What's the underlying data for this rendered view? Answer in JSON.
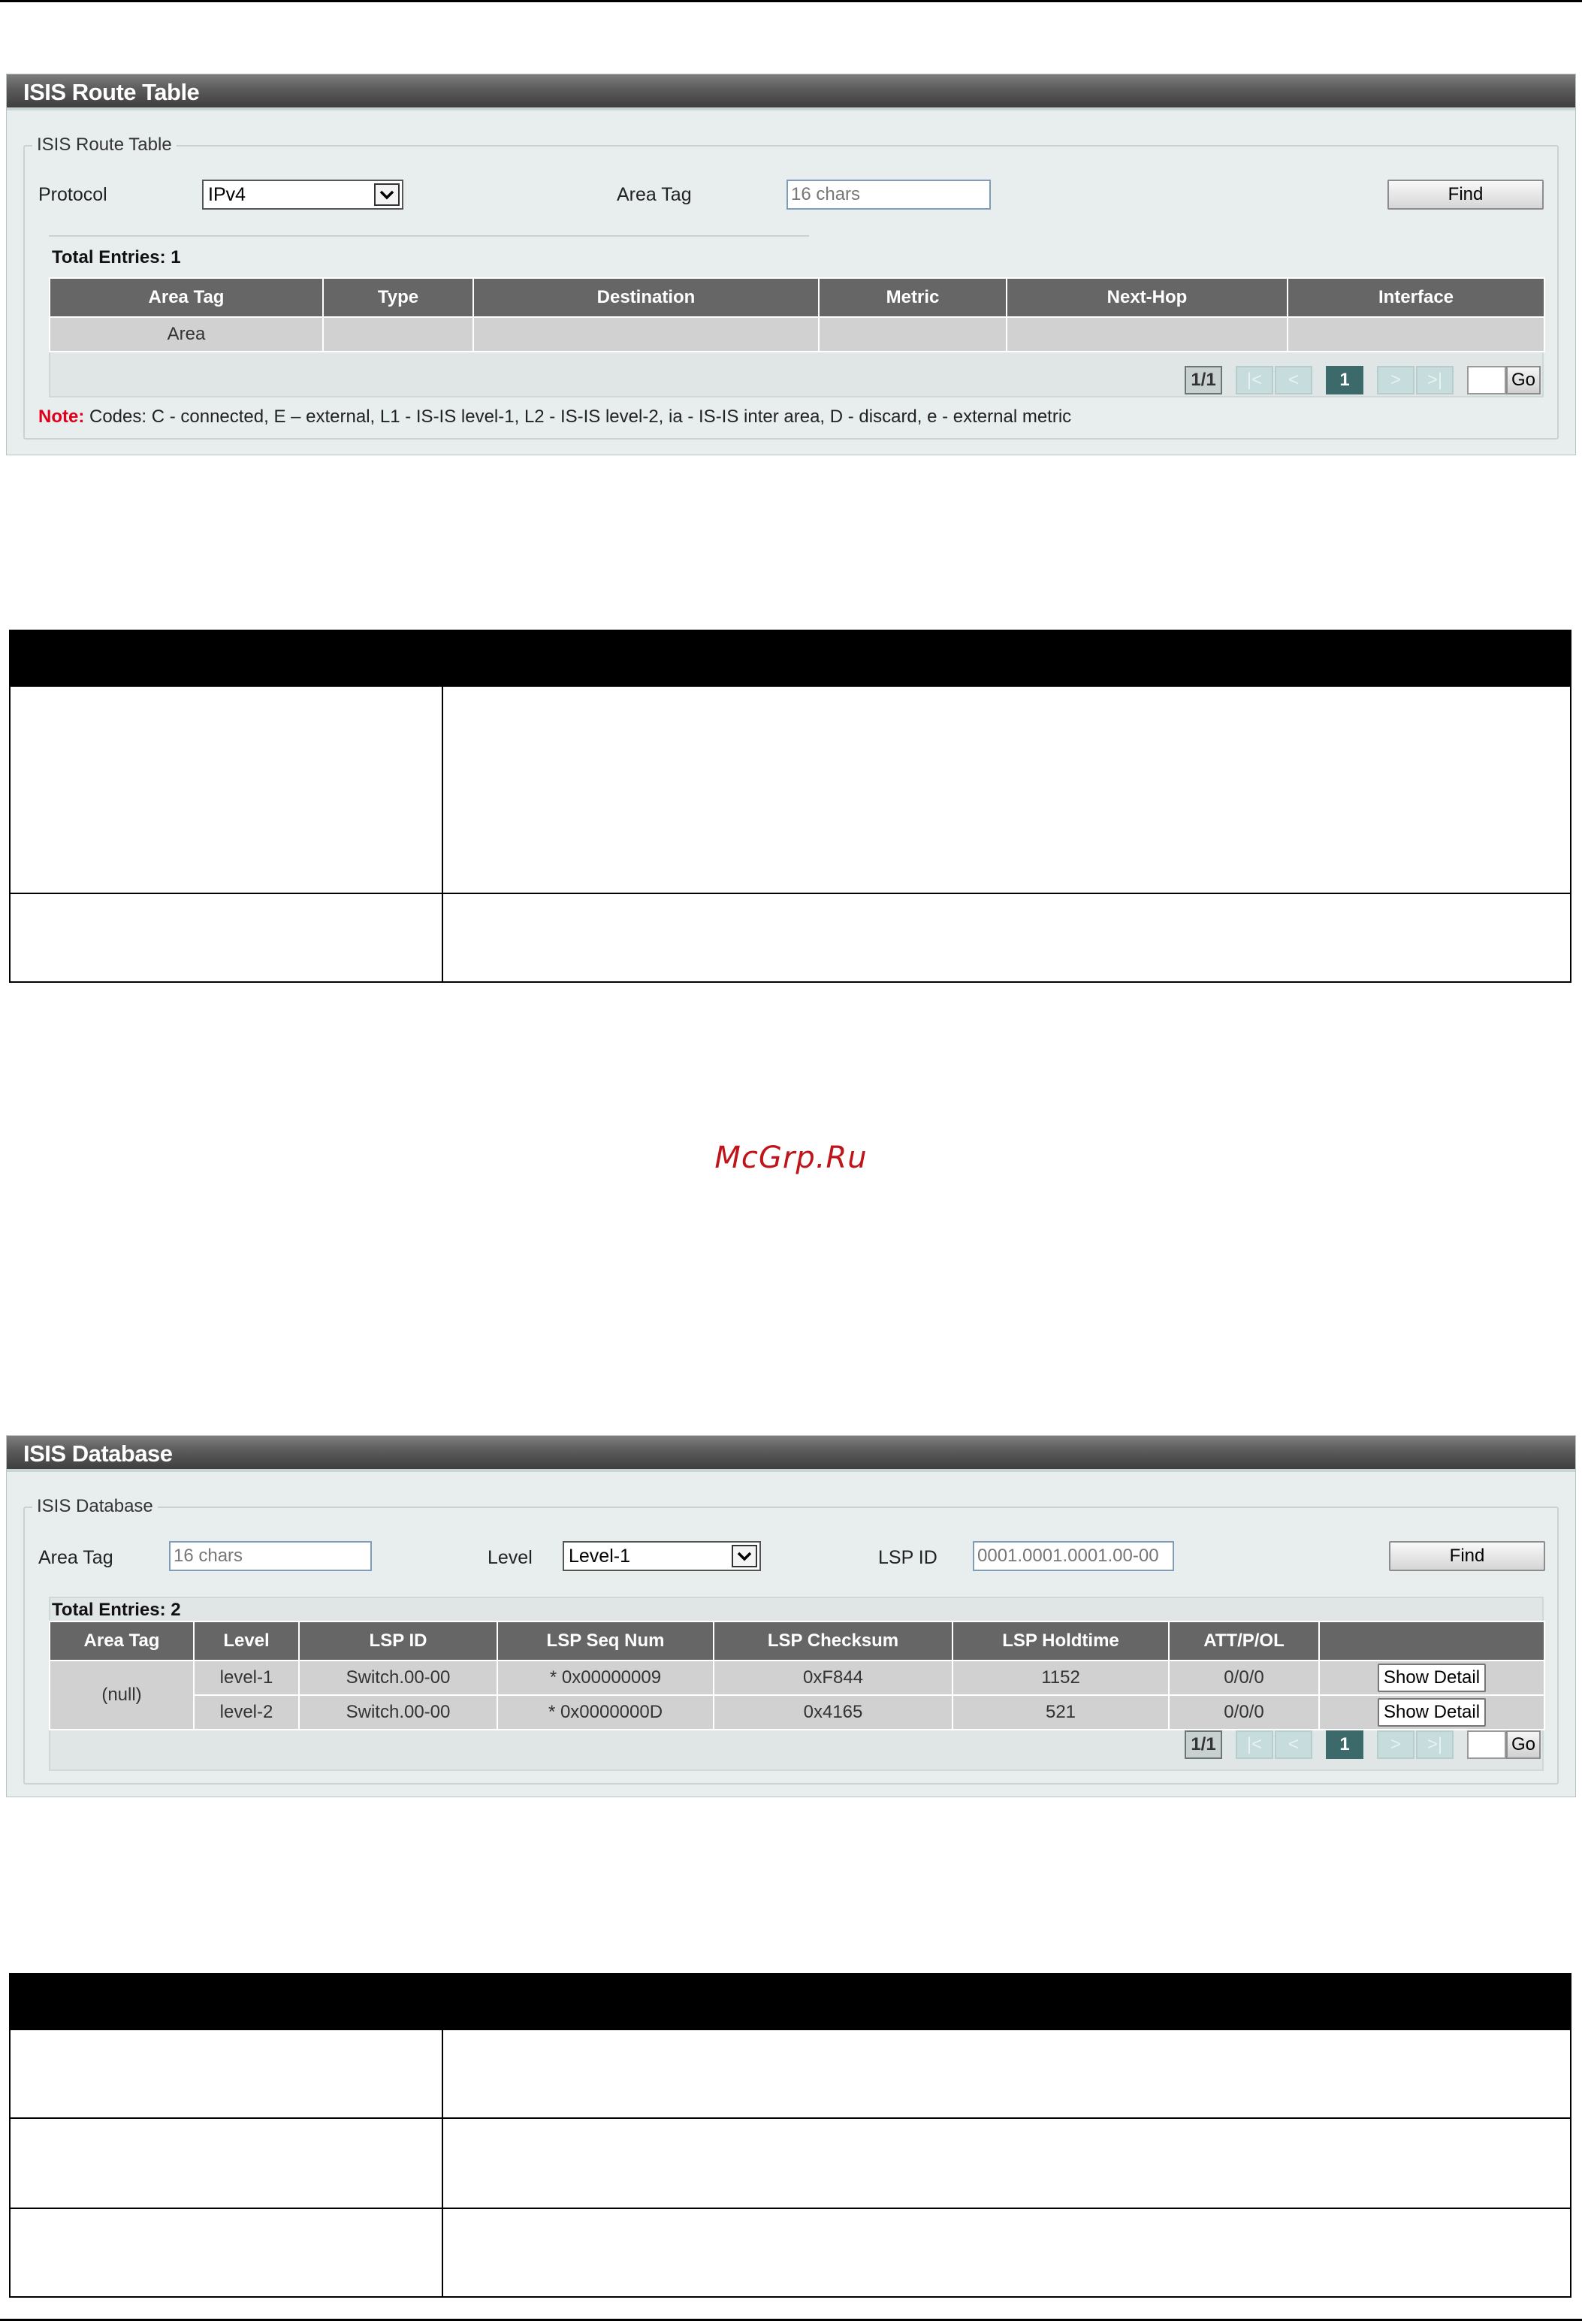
{
  "route_panel": {
    "title": "ISIS Route Table",
    "legend": "ISIS Route Table",
    "protocol_label": "Protocol",
    "protocol_value": "IPv4",
    "area_tag_label": "Area Tag",
    "area_tag_placeholder": "16 chars",
    "find_label": "Find",
    "total_entries": "Total Entries: 1",
    "columns": [
      "Area Tag",
      "Type",
      "Destination",
      "Metric",
      "Next-Hop",
      "Interface"
    ],
    "rows": [
      [
        "Area",
        "",
        "",
        "",
        "",
        ""
      ]
    ],
    "pager": {
      "count": "1/1",
      "first": "|<",
      "prev": "<",
      "page": "1",
      "next": ">",
      "last": ">|",
      "go": "Go"
    },
    "note_label": "Note:",
    "note_text": " Codes: C - connected, E – external, L1 - IS-IS level-1, L2 - IS-IS level-2, ia - IS-IS inter area, D - discard, e - external metric"
  },
  "database_panel": {
    "title": "ISIS Database",
    "legend": "ISIS Database",
    "area_tag_label": "Area Tag",
    "area_tag_placeholder": "16 chars",
    "level_label": "Level",
    "level_value": "Level-1",
    "lsp_id_label": "LSP ID",
    "lsp_id_placeholder": "0001.0001.0001.00-00",
    "find_label": "Find",
    "total_entries": "Total Entries: 2",
    "columns": [
      "Area Tag",
      "Level",
      "LSP ID",
      "LSP Seq Num",
      "LSP Checksum",
      "LSP Holdtime",
      "ATT/P/OL",
      ""
    ],
    "area_tag_value": "(null)",
    "rows": [
      {
        "level": "level-1",
        "lsp_id": "Switch.00-00",
        "seq": "* 0x00000009",
        "checksum": "0xF844",
        "holdtime": "1152",
        "att": "0/0/0",
        "action": "Show Detail"
      },
      {
        "level": "level-2",
        "lsp_id": "Switch.00-00",
        "seq": "* 0x0000000D",
        "checksum": "0x4165",
        "holdtime": "521",
        "att": "0/0/0",
        "action": "Show Detail"
      }
    ],
    "pager": {
      "count": "1/1",
      "first": "|<",
      "prev": "<",
      "page": "1",
      "next": ">",
      "last": ">|",
      "go": "Go"
    }
  },
  "watermark": "McGrp.Ru"
}
